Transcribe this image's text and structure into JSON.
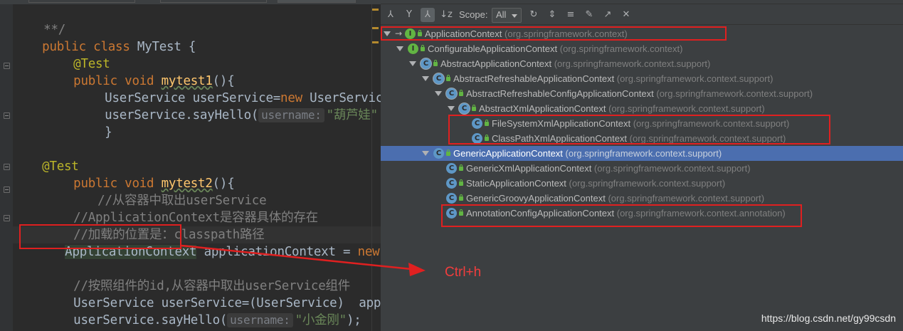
{
  "editor": {
    "comment_end": "**/",
    "class_decl": {
      "kw1": "public",
      "kw2": "class",
      "name": "MyTest {"
    },
    "test1": {
      "annotation": "@Test",
      "kw1": "public",
      "kw2": "void",
      "method": "mytest1",
      "after": "(){",
      "line1_a": "UserService userService=",
      "line1_kw": "new",
      "line1_b": " UserService",
      "line2_a": "userService.sayHello(",
      "line2_hint": "username:",
      "line2_str": "\"葫芦娃\"",
      "close": "}"
    },
    "test2": {
      "annotation": "@Test",
      "kw1": "public",
      "kw2": "void",
      "method": "mytest2",
      "after": "(){",
      "comment1": "//从容器中取出userService",
      "comment2": "//ApplicationContext是容器具体的存在",
      "comment3": "//加载的位置是：classpath路径",
      "decl_type": "ApplicationContext",
      "decl_rest": " applicationContext = ",
      "decl_kw": "new",
      "comment4": "//按照组件的id,从容器中取出userService组件",
      "line_cast": "UserService userService=(UserService)  appl",
      "line_say_a": "userService.sayHello(",
      "line_say_hint": "username:",
      "line_say_str": "\"小金刚\"",
      "line_say_end": ");"
    }
  },
  "hierarchy": {
    "toolbar": {
      "scope_label": "Scope:",
      "scope_value": "All",
      "icons": [
        "subtypes-hierarchy-icon",
        "supertypes-hierarchy-icon",
        "class-hierarchy-icon",
        "sort-alphabetically-icon",
        "refresh-icon",
        "expand-all-icon",
        "collapse-all-icon",
        "pin-icon",
        "export-icon",
        "close-icon"
      ]
    },
    "tree": [
      {
        "name": "ApplicationContext",
        "pkg": "(org.springframework.context)",
        "icon": "interface",
        "depth": 0,
        "expanded": true,
        "base": true
      },
      {
        "name": "ConfigurableApplicationContext",
        "pkg": "(org.springframework.context)",
        "icon": "interface",
        "depth": 1,
        "expanded": true
      },
      {
        "name": "AbstractApplicationContext",
        "pkg": "(org.springframework.context.support)",
        "icon": "abstract",
        "depth": 2,
        "expanded": true
      },
      {
        "name": "AbstractRefreshableApplicationContext",
        "pkg": "(org.springframework.context.support)",
        "icon": "abstract",
        "depth": 3,
        "expanded": true
      },
      {
        "name": "AbstractRefreshableConfigApplicationContext",
        "pkg": "(org.springframework.context.support)",
        "icon": "abstract",
        "depth": 4,
        "expanded": true
      },
      {
        "name": "AbstractXmlApplicationContext",
        "pkg": "(org.springframework.context.support)",
        "icon": "abstract",
        "depth": 5,
        "expanded": true
      },
      {
        "name": "FileSystemXmlApplicationContext",
        "pkg": "(org.springframework.context.support)",
        "icon": "class",
        "depth": 6
      },
      {
        "name": "ClassPathXmlApplicationContext",
        "pkg": "(org.springframework.context.support)",
        "icon": "class",
        "depth": 6
      },
      {
        "name": "GenericApplicationContext",
        "pkg": "(org.springframework.context.support)",
        "icon": "class",
        "depth": 3,
        "expanded": true,
        "selected": true
      },
      {
        "name": "GenericXmlApplicationContext",
        "pkg": "(org.springframework.context.support)",
        "icon": "class",
        "depth": 4
      },
      {
        "name": "StaticApplicationContext",
        "pkg": "(org.springframework.context.support)",
        "icon": "class",
        "depth": 4
      },
      {
        "name": "GenericGroovyApplicationContext",
        "pkg": "(org.springframework.context.support)",
        "icon": "class",
        "depth": 4
      },
      {
        "name": "AnnotationConfigApplicationContext",
        "pkg": "(org.springframework.context.annotation)",
        "icon": "class",
        "depth": 4
      }
    ]
  },
  "annotation": {
    "shortcut_label": "Ctrl+h",
    "color": "#e02020"
  },
  "watermark": "https://blog.csdn.net/gy99csdn"
}
